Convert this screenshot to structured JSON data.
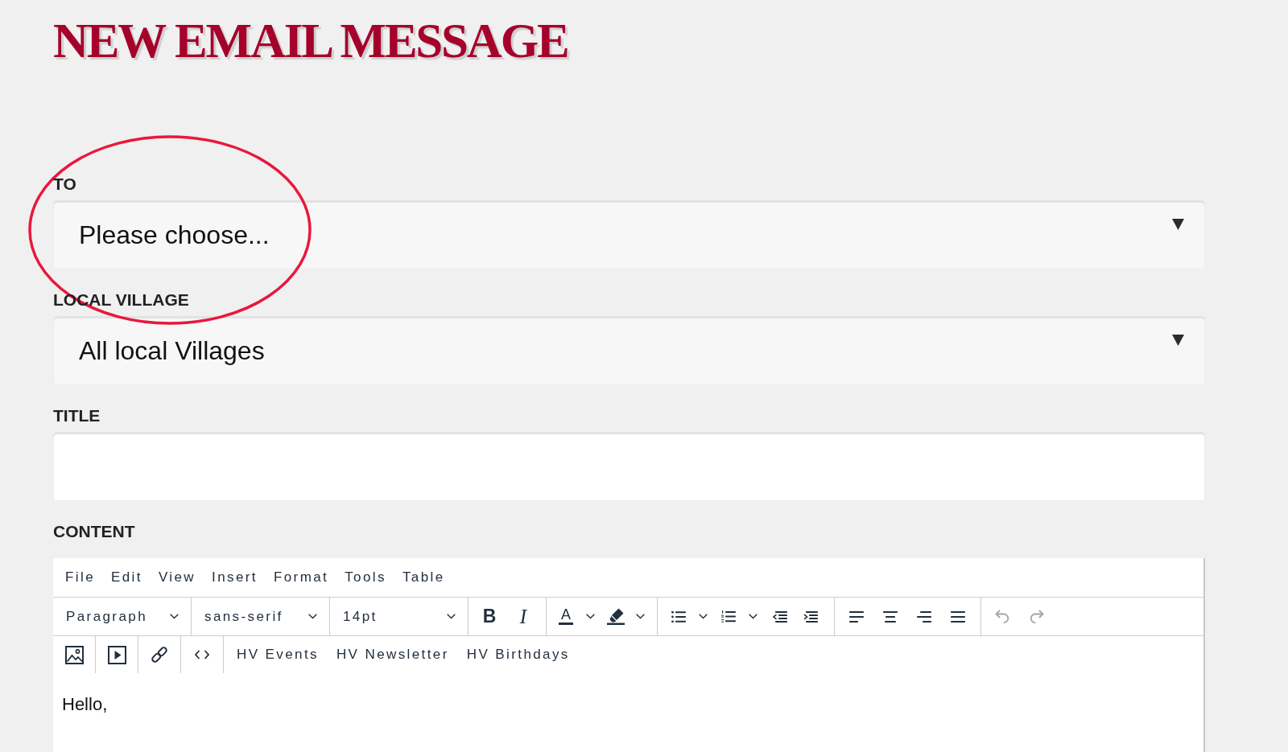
{
  "page_title": "NEW EMAIL MESSAGE",
  "fields": [
    {
      "kind": "select",
      "label": "TO",
      "value": "Please choose...",
      "highlighted": true
    },
    {
      "kind": "select",
      "label": "LOCAL VILLAGE",
      "value": "All local Villages",
      "highlighted": false
    },
    {
      "kind": "text",
      "label": "TITLE",
      "highlighted": false
    }
  ],
  "content": {
    "label": "CONTENT",
    "menubar": [
      "File",
      "Edit",
      "View",
      "Insert",
      "Format",
      "Tools",
      "Table"
    ],
    "format_dropdowns": [
      {
        "value": "Paragraph"
      },
      {
        "value": "sans-serif"
      },
      {
        "value": "14pt"
      }
    ],
    "style_buttons": [
      "B",
      "I"
    ],
    "text_color_button": "A",
    "history_buttons": [
      {
        "disabled": true
      },
      {
        "disabled": true
      }
    ],
    "custom_buttons": [
      "HV Events",
      "HV Newsletter",
      "HV Birthdays"
    ],
    "body": "Hello,"
  }
}
